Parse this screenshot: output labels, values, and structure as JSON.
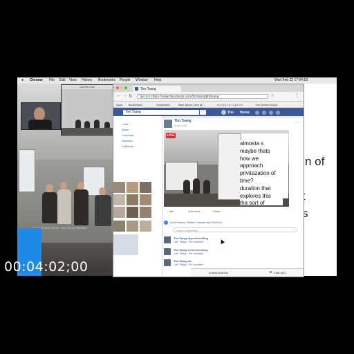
{
  "menubar": {
    "app": "Chrome",
    "items": [
      "File",
      "Edit",
      "View",
      "History",
      "Bookmarks",
      "People",
      "Window",
      "Help"
    ],
    "clock": "Wed Feb 22  17:54:18"
  },
  "camera": {
    "window_title": "Current Cell",
    "stamp": "2017-02-03 17:11:45 · 2017-02-03 16:53:41"
  },
  "browser": {
    "tab_title": "Tim Tsang",
    "url_secure": "Secure",
    "url": "https://www.facebook.com/timtsangtimtsang",
    "bookmarks": [
      "Apps",
      "Bookmarks",
      "Simplelabs",
      "Bare Aphex Twin ge...",
      "m o n k • p r o p h e t",
      "The Actual School"
    ],
    "fb_search": "Tim Tsang",
    "fb_user": "Tim",
    "fb_home": "Home"
  },
  "left_column": {
    "items": [
      "r Arts",
      "Music",
      "Columbia",
      "Artworks",
      "California"
    ]
  },
  "post": {
    "author": "Tim Tsang",
    "subtitle": "is live now.",
    "live_badge": "LIVE",
    "caption": [
      "almosta s",
      "maybe thats",
      "how we",
      "approach",
      "privitazation of",
      "time?",
      "duration that",
      "explores this",
      "tha sort of"
    ],
    "actions": [
      "Like",
      "Comment",
      "Share"
    ],
    "likes_line": "Lami Kasmu, Allister Capellio and 3 others",
    "write_comment": "Write a comment..."
  },
  "comments": [
    {
      "author": "Tim Tsang",
      "text": "hypertextedliting",
      "meta": "Like · Reply · Pin Comment"
    },
    {
      "author": "Tim Tsang",
      "text": "screenrecording",
      "meta": "Like · Reply · Pin Comment"
    },
    {
      "author": "Tim Tsang",
      "text": "fun",
      "meta": "Like · Reply · Pin Comment"
    }
  ],
  "chat": {
    "name": "Andrés Azerline",
    "label": "Chat (63)"
  },
  "slide": {
    "line1": "n of",
    "line2": "t",
    "line3": "s"
  },
  "video": {
    "timecode": "00:04:02;00"
  }
}
